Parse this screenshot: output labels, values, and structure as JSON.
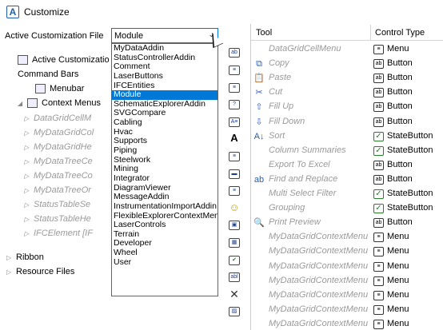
{
  "window": {
    "title": "Customize"
  },
  "active_file": {
    "label": "Active Customization File",
    "value": "Module"
  },
  "tree": [
    {
      "label": "Active Customizatio",
      "level": 1,
      "gray": false,
      "arrow": "",
      "icon": "file-icon"
    },
    {
      "label": "Command Bars",
      "level": 1,
      "gray": false,
      "arrow": "",
      "icon": ""
    },
    {
      "label": "Menubar",
      "level": 2,
      "gray": false,
      "arrow": "",
      "icon": "menu-icon"
    },
    {
      "label": "Context Menus",
      "level": 1,
      "gray": false,
      "arrow": "◢",
      "icon": "menu-icon"
    },
    {
      "label": "DataGridCellM",
      "level": 3,
      "gray": true,
      "arrow": "▷"
    },
    {
      "label": "MyDataGridCol",
      "level": 3,
      "gray": true,
      "arrow": "▷"
    },
    {
      "label": "MyDataGridHe",
      "level": 3,
      "gray": true,
      "arrow": "▷"
    },
    {
      "label": "MyDataTreeCe",
      "level": 3,
      "gray": true,
      "arrow": "▷"
    },
    {
      "label": "MyDataTreeCo",
      "level": 3,
      "gray": true,
      "arrow": "▷"
    },
    {
      "label": "MyDataTreeOr",
      "level": 3,
      "gray": true,
      "arrow": "▷"
    },
    {
      "label": "StatusTableSe",
      "level": 3,
      "gray": true,
      "arrow": "▷"
    },
    {
      "label": "StatusTableHe",
      "level": 3,
      "gray": true,
      "arrow": "▷"
    },
    {
      "label": "IFCElement [IF",
      "level": 3,
      "gray": true,
      "arrow": "▷"
    },
    {
      "label": "Ribbon",
      "level": 0,
      "gray": false,
      "arrow": "▷"
    },
    {
      "label": "Resource Files",
      "level": 0,
      "gray": false,
      "arrow": "▷"
    }
  ],
  "dropdown": {
    "selected": "Module",
    "items": [
      "MyDataAddin",
      "StatusControllerAddin",
      "Comment",
      "LaserButtons",
      "IFCEntities",
      "Module",
      "SchematicExplorerAddin",
      "SVGCompare",
      "Cabling",
      "Hvac",
      "Supports",
      "Piping",
      "Steelwork",
      "Mining",
      "Integrator",
      "DiagramViewer",
      "MessageAddin",
      "InstrumentationImportAddin",
      "FlexibleExplorerContextMen",
      "LaserControls",
      "Terrain",
      "Developer",
      "Wheel",
      "User"
    ]
  },
  "toolbar_icons": [
    "button-icon",
    "list-icon",
    "list-icon",
    "help-icon",
    "text-icon",
    "font-icon",
    "list-icon",
    "separator-icon",
    "list-icon",
    "smiley-icon",
    "image-icon",
    "grid-icon",
    "checkbox-icon",
    "label-icon",
    "delete-icon",
    "picture-icon"
  ],
  "grid": {
    "col_tool": "Tool",
    "col_type": "Control Type",
    "rows": [
      {
        "tool": "DataGridCellMenu",
        "type": "Menu",
        "tool_icon": "",
        "type_icon": "menu"
      },
      {
        "tool": "Copy",
        "type": "Button",
        "tool_icon": "copy-icon",
        "type_icon": "button"
      },
      {
        "tool": "Paste",
        "type": "Button",
        "tool_icon": "paste-icon",
        "type_icon": "button"
      },
      {
        "tool": "Cut",
        "type": "Button",
        "tool_icon": "cut-icon",
        "type_icon": "button"
      },
      {
        "tool": "Fill Up",
        "type": "Button",
        "tool_icon": "fill-up-icon",
        "type_icon": "button"
      },
      {
        "tool": "Fill Down",
        "type": "Button",
        "tool_icon": "fill-down-icon",
        "type_icon": "button"
      },
      {
        "tool": "Sort",
        "type": "StateButton",
        "tool_icon": "sort-icon",
        "type_icon": "check"
      },
      {
        "tool": "Column Summaries",
        "type": "StateButton",
        "tool_icon": "",
        "type_icon": "check"
      },
      {
        "tool": "Export To Excel",
        "type": "Button",
        "tool_icon": "",
        "type_icon": "button"
      },
      {
        "tool": "Find and Replace",
        "type": "Button",
        "tool_icon": "find-icon",
        "type_icon": "button"
      },
      {
        "tool": "Multi Select Filter",
        "type": "StateButton",
        "tool_icon": "",
        "type_icon": "check"
      },
      {
        "tool": "Grouping",
        "type": "StateButton",
        "tool_icon": "",
        "type_icon": "check"
      },
      {
        "tool": "Print Preview",
        "type": "Button",
        "tool_icon": "print-preview-icon",
        "type_icon": "button"
      },
      {
        "tool": "MyDataGridContextMenu",
        "type": "Menu",
        "tool_icon": "",
        "type_icon": "menu"
      },
      {
        "tool": "MyDataGridContextMenu",
        "type": "Menu",
        "tool_icon": "",
        "type_icon": "menu"
      },
      {
        "tool": "MyDataGridContextMenu",
        "type": "Menu",
        "tool_icon": "",
        "type_icon": "menu"
      },
      {
        "tool": "MyDataGridContextMenu",
        "type": "Menu",
        "tool_icon": "",
        "type_icon": "menu"
      },
      {
        "tool": "MyDataGridContextMenu",
        "type": "Menu",
        "tool_icon": "",
        "type_icon": "menu"
      },
      {
        "tool": "MyDataGridContextMenu",
        "type": "Menu",
        "tool_icon": "",
        "type_icon": "menu"
      },
      {
        "tool": "MyDataGridContextMenu",
        "type": "Menu",
        "tool_icon": "",
        "type_icon": "menu"
      }
    ]
  },
  "colors": {
    "accent": "#0078d7",
    "gray_text": "#9a9a9a"
  }
}
